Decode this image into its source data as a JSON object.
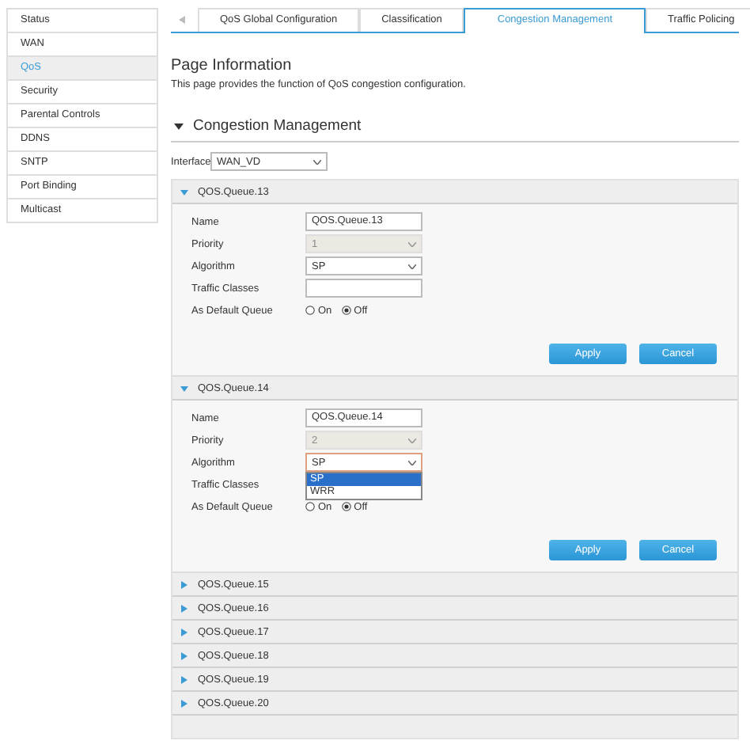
{
  "sidebar": {
    "items": [
      {
        "label": "Status",
        "selected": false
      },
      {
        "label": "WAN",
        "selected": false
      },
      {
        "label": "QoS",
        "selected": true
      },
      {
        "label": "Security",
        "selected": false
      },
      {
        "label": "Parental Controls",
        "selected": false
      },
      {
        "label": "DDNS",
        "selected": false
      },
      {
        "label": "SNTP",
        "selected": false
      },
      {
        "label": "Port Binding",
        "selected": false
      },
      {
        "label": "Multicast",
        "selected": false
      }
    ]
  },
  "tabs": [
    {
      "label": "QoS Global Configuration",
      "selected": false
    },
    {
      "label": "Classification",
      "selected": false
    },
    {
      "label": "Congestion Management",
      "selected": true
    },
    {
      "label": "Traffic Policing",
      "selected": false
    }
  ],
  "page_info": {
    "title": "Page Information",
    "description": "This page provides the function of QoS congestion configuration."
  },
  "section": {
    "title": "Congestion Management",
    "expanded": true
  },
  "interface": {
    "label": "Interface",
    "value": "WAN_VD"
  },
  "queues": [
    {
      "title": "QOS.Queue.13",
      "expanded": true,
      "name_label": "Name",
      "name": "QOS.Queue.13",
      "priority_label": "Priority",
      "priority": "1",
      "priority_disabled": true,
      "algorithm_label": "Algorithm",
      "algorithm": "SP",
      "traffic_label": "Traffic Classes",
      "default_label": "As Default Queue",
      "default_options": [
        {
          "label": "On",
          "selected": false
        },
        {
          "label": "Off",
          "selected": true
        }
      ],
      "buttons": [
        "Apply",
        "Cancel"
      ]
    },
    {
      "title": "QOS.Queue.14",
      "expanded": true,
      "name_label": "Name",
      "name": "QOS.Queue.14",
      "priority_label": "Priority",
      "priority": "2",
      "priority_disabled": true,
      "algorithm_label": "Algorithm",
      "algorithm": "SP",
      "dropdown_options": [
        {
          "label": "SP",
          "selected": true
        },
        {
          "label": "WRR",
          "selected": false
        }
      ],
      "traffic_label": "Traffic Classes",
      "default_label": "As Default Queue",
      "default_options": [
        {
          "label": "On",
          "selected": false
        },
        {
          "label": "Off",
          "selected": true
        }
      ],
      "buttons": [
        "Apply",
        "Cancel"
      ]
    },
    {
      "title": "QOS.Queue.15",
      "expanded": false
    },
    {
      "title": "QOS.Queue.16",
      "expanded": false
    },
    {
      "title": "QOS.Queue.17",
      "expanded": false
    },
    {
      "title": "QOS.Queue.18",
      "expanded": false
    },
    {
      "title": "QOS.Queue.19",
      "expanded": false
    },
    {
      "title": "QOS.Queue.20",
      "expanded": false
    }
  ]
}
